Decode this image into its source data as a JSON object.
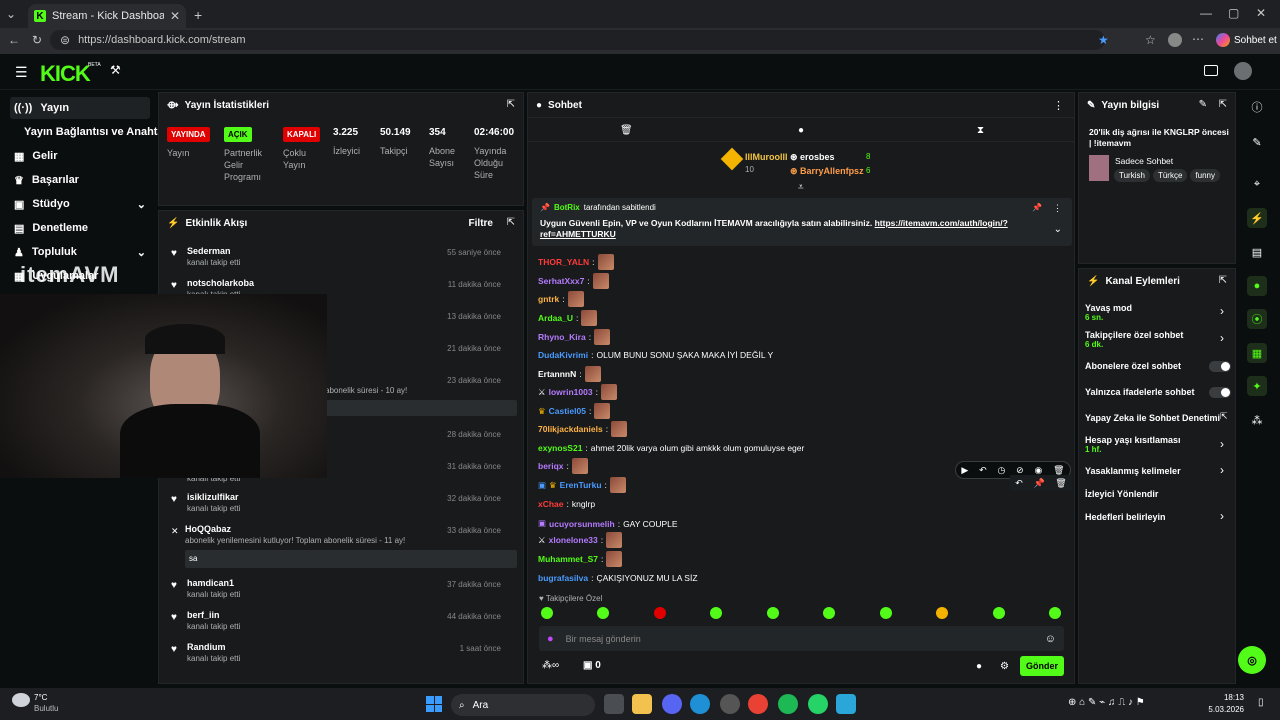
{
  "browser": {
    "tab_title": "Stream - Kick Dashboard",
    "url": "https://dashboard.kick.com/stream",
    "profile_label": "Sohbet et"
  },
  "header": {
    "logo": "KICK",
    "beta": "BETA"
  },
  "sidebar": {
    "items": [
      {
        "label": "Yayın"
      },
      {
        "label": "Yayın Bağlantısı ve Anahtarı"
      },
      {
        "label": "Gelir"
      },
      {
        "label": "Başarılar"
      },
      {
        "label": "Stüdyo"
      },
      {
        "label": "Denetleme"
      },
      {
        "label": "Topluluk"
      },
      {
        "label": "Uygulamalar"
      }
    ]
  },
  "overlay": {
    "text": "itemAVM"
  },
  "stats": {
    "title": "Yayın İstatistikleri",
    "badges": [
      {
        "label": "YAYINDA",
        "color": "#e00000",
        "caption": "Yayın"
      },
      {
        "label": "AÇIK",
        "color": "#53fc18",
        "caption": "Partnerlik Gelir Programı"
      },
      {
        "label": "KAPALI",
        "color": "#e00000",
        "caption": "Çoklu Yayın"
      }
    ],
    "numbers": [
      {
        "value": "3.225",
        "label": "İzleyici"
      },
      {
        "value": "50.149",
        "label": "Takipçi"
      },
      {
        "value": "354",
        "label": "Abone Sayısı"
      },
      {
        "value": "02:46:00",
        "label": "Yayında Olduğu Süre"
      }
    ]
  },
  "activity": {
    "title": "Etkinlik Akışı",
    "filter": "Filtre",
    "items": [
      {
        "user": "Sederman",
        "desc": "kanalı takip etti",
        "time": "55 saniye önce"
      },
      {
        "user": "notscholarkoba",
        "desc": "kanalı takip etti",
        "time": "11 dakika önce"
      },
      {
        "user": "",
        "desc": "",
        "time": "13 dakika önce"
      },
      {
        "user": "",
        "desc": "",
        "time": "21 dakika önce"
      },
      {
        "user": "",
        "desc": "abonelik süresi - 10 ay!",
        "time": "23 dakika önce"
      },
      {
        "user": "",
        "desc": "",
        "time": "28 dakika önce"
      },
      {
        "user": "",
        "desc": "kanalı takip etti",
        "time": "31 dakika önce"
      },
      {
        "user": "isiklizulfikar",
        "desc": "kanalı takip etti",
        "time": "32 dakika önce"
      },
      {
        "user": "HoQQabaz",
        "desc": "abonelik yenilemesini kutluyor! Toplam abonelik süresi - 11 ay!",
        "time": "33 dakika önce",
        "msg": "sa"
      },
      {
        "user": "hamdican1",
        "desc": "kanalı takip etti",
        "time": "37 dakika önce"
      },
      {
        "user": "berf_iin",
        "desc": "kanalı takip etti",
        "time": "44 dakika önce"
      },
      {
        "user": "Randium",
        "desc": "kanalı takip etti",
        "time": "1 saat önce"
      }
    ]
  },
  "chat": {
    "title": "Sohbet",
    "top": [
      {
        "name": "lllMuroolll",
        "count": "10"
      },
      {
        "name": "erosbes",
        "count": "8"
      },
      {
        "name": "BarryAllenfpsz",
        "count": "6"
      }
    ],
    "pinned": {
      "by": "BotRix",
      "by_suffix": "tarafından sabitlendi",
      "text": "Uygun Güvenli Epin, VP ve Oyun Kodlarını İTEMAVM aracılığıyla satın alabilirsiniz.",
      "link": "https://itemavm.com/auth/login/?ref=AHMETTURKU"
    },
    "messages": [
      {
        "user": "THOR_YALN",
        "color": "#ff3b3b",
        "text": ""
      },
      {
        "user": "SerhatXxx7",
        "color": "#b57bff",
        "text": ""
      },
      {
        "user": "gntrk",
        "color": "#ffb347",
        "text": ""
      },
      {
        "user": "Ardaa_U",
        "color": "#53fc18",
        "text": ""
      },
      {
        "user": "Rhyno_Kira",
        "color": "#b57bff",
        "text": ""
      },
      {
        "user": "DudaKivrimi",
        "color": "#4a9bff",
        "text": "OLUM BUNU SONU ŞAKA MAKA İYİ DEĞİL Y"
      },
      {
        "user": "ErtannnN",
        "color": "#ffffff",
        "text": ""
      },
      {
        "user": "lowrin1003",
        "color": "#b57bff",
        "text": ""
      },
      {
        "user": "Castiel05",
        "color": "#4a9bff",
        "text": ""
      },
      {
        "user": "70likjackdaniels",
        "color": "#ffb347",
        "text": ""
      },
      {
        "user": "exynosS21",
        "color": "#53fc18",
        "text": "ahmet 20lik varya olum gibi amkkk olum gomuluyse eger"
      },
      {
        "user": "beriqx",
        "color": "#b57bff",
        "text": ""
      },
      {
        "user": "ErenTurku",
        "color": "#4a9bff",
        "text": ""
      },
      {
        "user": "xChae",
        "color": "#ff3b3b",
        "text": "knglrp"
      },
      {
        "user": "ucuyorsunmelih",
        "color": "#b57bff",
        "text": "GAY COUPLE"
      },
      {
        "user": "xlonelone33",
        "color": "#b57bff",
        "text": ""
      },
      {
        "user": "Muhammet_S7",
        "color": "#53fc18",
        "text": ""
      },
      {
        "user": "bugrafasilva",
        "color": "#4a9bff",
        "text": "ÇAKIŞIYONUZ MU LA SİZ"
      }
    ],
    "followers_only": "Takipçilere Özel",
    "placeholder": "Bir mesaj gönderin",
    "send": "Gönder",
    "count": "0"
  },
  "stream_info": {
    "title": "Yayın bilgisi",
    "stream_title": "20'lik diş ağrısı ile KNGLRP öncesi | !itemavm",
    "category": "Sadece Sohbet",
    "tags": [
      "Turkish",
      "Türkçe",
      "funny"
    ]
  },
  "channel_actions": {
    "title": "Kanal Eylemleri",
    "items": [
      {
        "label": "Yavaş mod",
        "sub": "6 sn.",
        "type": "chev"
      },
      {
        "label": "Takipçilere özel sohbet",
        "sub": "6 dk.",
        "type": "chev"
      },
      {
        "label": "Abonelere özel sohbet",
        "sub": "",
        "type": "toggle"
      },
      {
        "label": "Yalnızca ifadelerle sohbet",
        "sub": "",
        "type": "toggle"
      },
      {
        "label": "Yapay Zeka ile Sohbet Denetimi",
        "sub": "",
        "type": "ext"
      },
      {
        "label": "Hesap yaşı kısıtlaması",
        "sub": "1 hf.",
        "type": "chev"
      },
      {
        "label": "Yasaklanmış kelimeler",
        "sub": "",
        "type": "chev"
      },
      {
        "label": "İzleyici Yönlendir",
        "sub": "",
        "type": "none"
      },
      {
        "label": "Hedefleri belirleyin",
        "sub": "",
        "type": "chev"
      }
    ]
  },
  "taskbar": {
    "weather_temp": "7°C",
    "weather_desc": "Bulutlu",
    "search": "Ara",
    "time": "18:13",
    "date": "5.03.2026"
  }
}
